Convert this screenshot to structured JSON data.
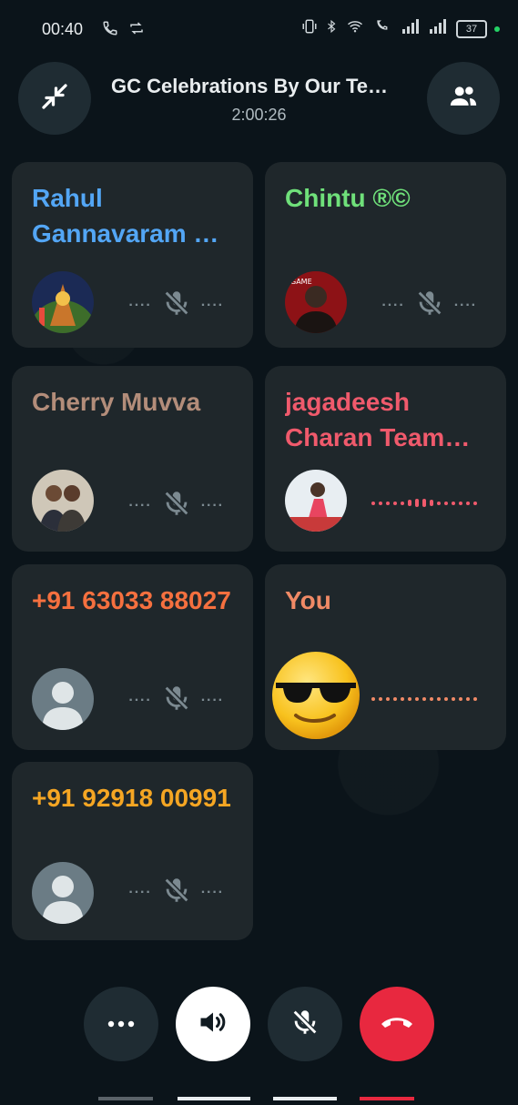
{
  "status_bar": {
    "time": "00:40",
    "battery": "37"
  },
  "call": {
    "title": "GC Celebrations By Our Te…",
    "timer": "2:00:26"
  },
  "participants": [
    {
      "name": "Rahul Gannavaram …",
      "color": "#53a6f5",
      "avatar": "photo-avatar",
      "state": "muted"
    },
    {
      "name": "Chintu ®©",
      "color": "#6fe07a",
      "avatar": "photo-avatar",
      "state": "muted"
    },
    {
      "name": "Cherry Muvva",
      "color": "#b38d7a",
      "avatar": "photo-avatar",
      "state": "muted"
    },
    {
      "name": "jagadeesh Charan Team…",
      "color": "#f05a6c",
      "avatar": "photo-avatar",
      "state": "speaking"
    },
    {
      "name": "+91 63033 88027",
      "color": "#f5703f",
      "avatar": "default-avatar",
      "state": "muted"
    },
    {
      "name": "You",
      "color": "#f08a66",
      "avatar": "sunglasses-emoji",
      "state": "speaking"
    },
    {
      "name": "+91 92918 00991",
      "color": "#f5a623",
      "avatar": "default-avatar",
      "state": "muted"
    }
  ],
  "controls": {
    "more": "more-options-icon",
    "speaker": "speaker-icon",
    "mute": "mic-off-icon",
    "end": "end-call-icon"
  },
  "colors": {
    "end_call": "#e8283f",
    "speaker_active": "#ffffff",
    "tile_bg": "#1f272b"
  }
}
